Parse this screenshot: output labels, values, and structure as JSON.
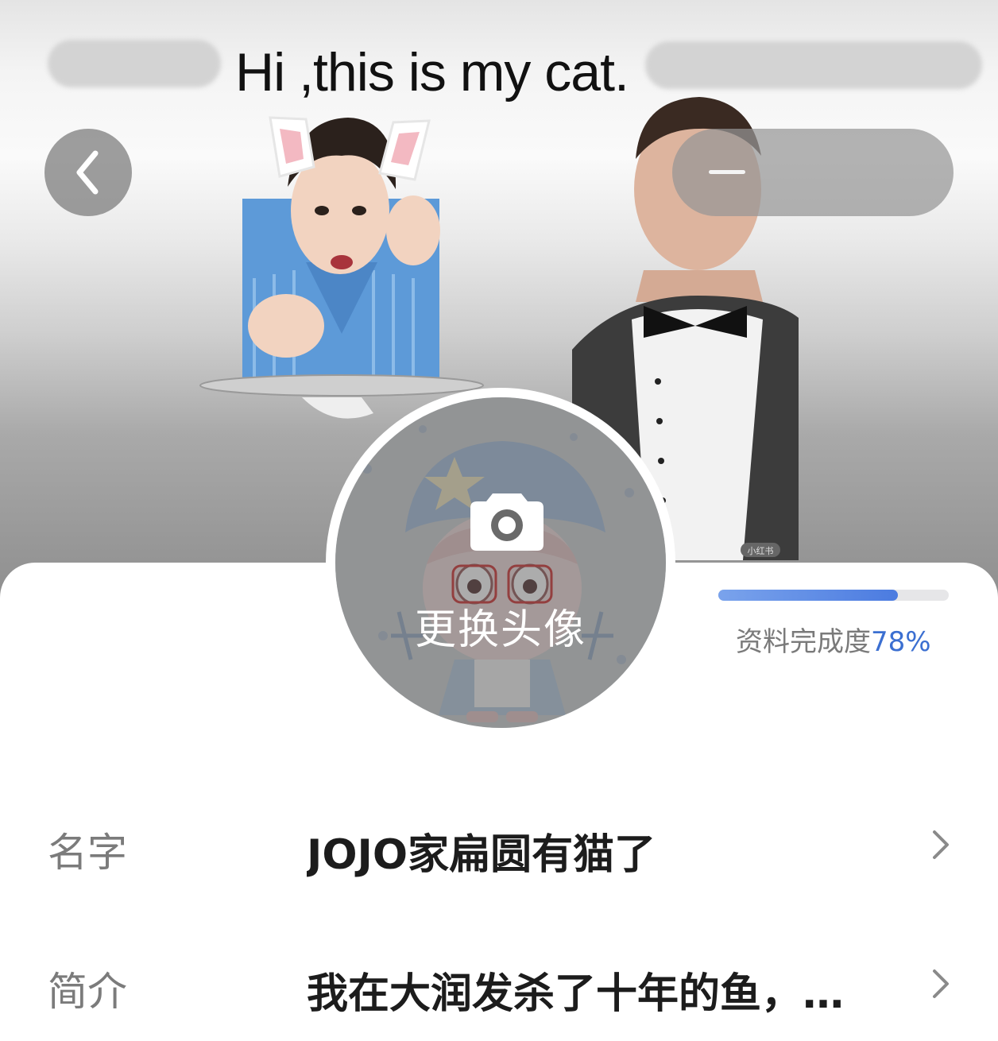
{
  "header": {
    "meme_caption": "Hi ,this is my cat.",
    "back_icon": "chevron-left-icon",
    "watermark": "小红书"
  },
  "avatar": {
    "change_label": "更换头像",
    "icon": "camera-icon"
  },
  "completion": {
    "label": "资料完成度",
    "percent_text": "78%",
    "value": 0.78,
    "colors": {
      "fill": "#4b7be0",
      "track": "#e6e6e8",
      "percent": "#3b6fd1"
    }
  },
  "profile": {
    "name_label": "名字",
    "name_value": "JOJO家扁圆有猫了",
    "bio_label": "简介",
    "bio_value": "我在大润发杀了十年的鱼，…"
  }
}
